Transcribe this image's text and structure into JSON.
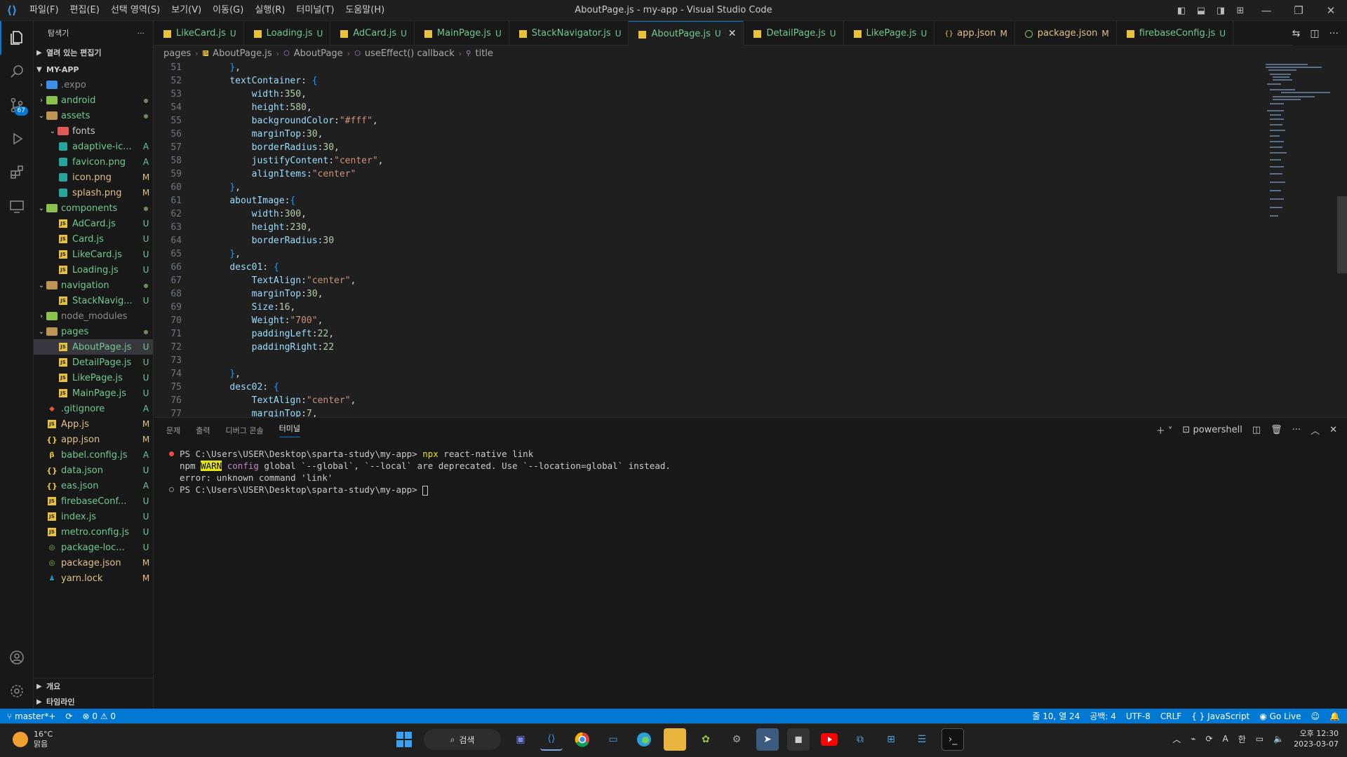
{
  "titlebar": {
    "title": "AboutPage.js - my-app - Visual Studio Code",
    "menus": [
      "파일(F)",
      "편집(E)",
      "선택 영역(S)",
      "보기(V)",
      "이동(G)",
      "실행(R)",
      "터미널(T)",
      "도움말(H)"
    ]
  },
  "activity": {
    "scm_badge": "67"
  },
  "sidebar": {
    "title": "탐색기",
    "open_editors": "열려 있는 편집기",
    "project": "MY-APP",
    "outline": "개요",
    "timeline": "타임라인",
    "tree": [
      {
        "name": ".expo",
        "type": "folder-special",
        "level": 1,
        "open": false,
        "status": ""
      },
      {
        "name": "android",
        "type": "folder-green",
        "level": 1,
        "open": false,
        "status": "●"
      },
      {
        "name": "assets",
        "type": "folder",
        "level": 1,
        "open": true,
        "status": "●"
      },
      {
        "name": "fonts",
        "type": "folder-red",
        "level": 2,
        "open": true,
        "status": ""
      },
      {
        "name": "adaptive-ic...",
        "type": "img",
        "level": 2,
        "status": "A"
      },
      {
        "name": "favicon.png",
        "type": "img",
        "level": 2,
        "status": "A"
      },
      {
        "name": "icon.png",
        "type": "img",
        "level": 2,
        "status": "M"
      },
      {
        "name": "splash.png",
        "type": "img",
        "level": 2,
        "status": "M"
      },
      {
        "name": "components",
        "type": "folder-green",
        "level": 1,
        "open": true,
        "status": "●"
      },
      {
        "name": "AdCard.js",
        "type": "js",
        "level": 2,
        "status": "U"
      },
      {
        "name": "Card.js",
        "type": "js",
        "level": 2,
        "status": "U"
      },
      {
        "name": "LikeCard.js",
        "type": "js",
        "level": 2,
        "status": "U"
      },
      {
        "name": "Loading.js",
        "type": "js",
        "level": 2,
        "status": "U"
      },
      {
        "name": "navigation",
        "type": "folder",
        "level": 1,
        "open": true,
        "status": "●"
      },
      {
        "name": "StackNavig...",
        "type": "js",
        "level": 2,
        "status": "U"
      },
      {
        "name": "node_modules",
        "type": "folder-green",
        "level": 1,
        "open": false,
        "status": ""
      },
      {
        "name": "pages",
        "type": "folder",
        "level": 1,
        "open": true,
        "status": "●"
      },
      {
        "name": "AboutPage.js",
        "type": "js",
        "level": 2,
        "status": "U",
        "selected": true
      },
      {
        "name": "DetailPage.js",
        "type": "js",
        "level": 2,
        "status": "U"
      },
      {
        "name": "LikePage.js",
        "type": "js",
        "level": 2,
        "status": "U"
      },
      {
        "name": "MainPage.js",
        "type": "js",
        "level": 2,
        "status": "U"
      },
      {
        "name": ".gitignore",
        "type": "git",
        "level": 1,
        "status": "A"
      },
      {
        "name": "App.js",
        "type": "js",
        "level": 1,
        "status": "M"
      },
      {
        "name": "app.json",
        "type": "json",
        "level": 1,
        "status": "M"
      },
      {
        "name": "babel.config.js",
        "type": "babel",
        "level": 1,
        "status": "A"
      },
      {
        "name": "data.json",
        "type": "json",
        "level": 1,
        "status": "U"
      },
      {
        "name": "eas.json",
        "type": "json",
        "level": 1,
        "status": "A"
      },
      {
        "name": "firebaseConf...",
        "type": "js",
        "level": 1,
        "status": "U"
      },
      {
        "name": "index.js",
        "type": "js",
        "level": 1,
        "status": "U"
      },
      {
        "name": "metro.config.js",
        "type": "js",
        "level": 1,
        "status": "U"
      },
      {
        "name": "package-loc...",
        "type": "pkg",
        "level": 1,
        "status": "U"
      },
      {
        "name": "package.json",
        "type": "pkg",
        "level": 1,
        "status": "M"
      },
      {
        "name": "yarn.lock",
        "type": "yarn",
        "level": 1,
        "status": "M"
      }
    ]
  },
  "tabs": [
    {
      "label": "LikeCard.js",
      "status": "U"
    },
    {
      "label": "Loading.js",
      "status": "U"
    },
    {
      "label": "AdCard.js",
      "status": "U"
    },
    {
      "label": "MainPage.js",
      "status": "U"
    },
    {
      "label": "StackNavigator.js",
      "status": "U"
    },
    {
      "label": "AboutPage.js",
      "status": "U",
      "active": true
    },
    {
      "label": "DetailPage.js",
      "status": "U"
    },
    {
      "label": "LikePage.js",
      "status": "U"
    },
    {
      "label": "app.json",
      "status": "M",
      "icon": "json"
    },
    {
      "label": "package.json",
      "status": "M",
      "icon": "pkg"
    },
    {
      "label": "firebaseConfig.js",
      "status": "U"
    }
  ],
  "breadcrumb": [
    "pages",
    "AboutPage.js",
    "AboutPage",
    "useEffect() callback",
    "title"
  ],
  "code": [
    {
      "n": "51",
      "t": "    },"
    },
    {
      "n": "52",
      "t": "    textContainer: {"
    },
    {
      "n": "53",
      "t": "        width:350,"
    },
    {
      "n": "54",
      "t": "        height:580,"
    },
    {
      "n": "55",
      "t": "        backgroundColor:\"#fff\","
    },
    {
      "n": "56",
      "t": "        marginTop:30,"
    },
    {
      "n": "57",
      "t": "        borderRadius:30,"
    },
    {
      "n": "58",
      "t": "        justifyContent:\"center\","
    },
    {
      "n": "59",
      "t": "        alignItems:\"center\""
    },
    {
      "n": "60",
      "t": "    },"
    },
    {
      "n": "61",
      "t": "    aboutImage:{"
    },
    {
      "n": "62",
      "t": "        width:300,"
    },
    {
      "n": "63",
      "t": "        height:230,"
    },
    {
      "n": "64",
      "t": "        borderRadius:30"
    },
    {
      "n": "65",
      "t": "    },"
    },
    {
      "n": "66",
      "t": "    desc01: {"
    },
    {
      "n": "67",
      "t": "        TextAlign:\"center\","
    },
    {
      "n": "68",
      "t": "        marginTop:30,"
    },
    {
      "n": "69",
      "t": "        Size:16,"
    },
    {
      "n": "70",
      "t": "        Weight:\"700\","
    },
    {
      "n": "71",
      "t": "        paddingLeft:22,"
    },
    {
      "n": "72",
      "t": "        paddingRight:22"
    },
    {
      "n": "73",
      "t": ""
    },
    {
      "n": "74",
      "t": "    },"
    },
    {
      "n": "75",
      "t": "    desc02: {"
    },
    {
      "n": "76",
      "t": "        TextAlign:\"center\","
    },
    {
      "n": "77",
      "t": "        marginTop:7,"
    }
  ],
  "panel": {
    "tabs": [
      "문제",
      "출력",
      "디버그 콘솔",
      "터미널"
    ],
    "shell": "powershell",
    "lines": {
      "l1_prompt": "PS C:\\Users\\USER\\Desktop\\sparta-study\\my-app> ",
      "l1_npx": "npx",
      "l1_rest": " react-native link",
      "l2_npm": "npm ",
      "l2_warn": "WARN",
      "l2_cfg": " config",
      "l2_rest": " global `--global`, `--local` are deprecated. Use `--location=global` instead.",
      "l3": "error: unknown command 'link'",
      "l4_prompt": "PS C:\\Users\\USER\\Desktop\\sparta-study\\my-app> "
    }
  },
  "status": {
    "branch": "master*+",
    "errors": "0",
    "warnings": "0",
    "position": "줄 10, 열 24",
    "spaces": "공백: 4",
    "encoding": "UTF-8",
    "eol": "CRLF",
    "language": "JavaScript",
    "golive": "Go Live"
  },
  "taskbar": {
    "temp": "16°C",
    "weather": "맑음",
    "search": "검색",
    "time": "오후 12:30",
    "date": "2023-03-07",
    "ime": "한"
  }
}
